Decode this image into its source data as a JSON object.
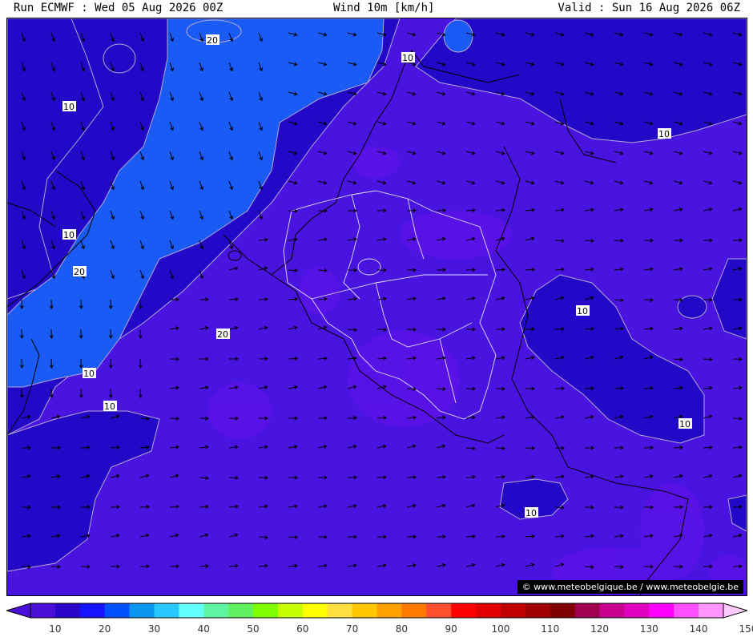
{
  "header": {
    "run": "Run ECMWF : Wed 05 Aug 2026 00Z",
    "field": "Wind 10m [km/h]",
    "valid": "Valid : Sun 16 Aug 2026 06Z"
  },
  "credit": "© www.meteobelgique.be / www.meteobelgie.be",
  "contour_labels": [
    "20",
    "10",
    "10",
    "10",
    "10",
    "20",
    "10",
    "20",
    "10",
    "10",
    "10",
    "10"
  ],
  "colorbar": {
    "labels": [
      "10",
      "20",
      "30",
      "40",
      "50",
      "60",
      "70",
      "80",
      "90",
      "100",
      "110",
      "120",
      "130",
      "140",
      "150"
    ],
    "colors": [
      "#4b10d8",
      "#2a06c8",
      "#1414ff",
      "#0050ff",
      "#0a96f0",
      "#28c8ff",
      "#64ffff",
      "#5ef5a0",
      "#60f060",
      "#7fff00",
      "#c8ff00",
      "#ffff00",
      "#ffe040",
      "#ffc800",
      "#ffa000",
      "#ff7800",
      "#ff5030",
      "#ff0000",
      "#e00000",
      "#c00000",
      "#a00000",
      "#800000",
      "#a00050",
      "#c80090",
      "#e000c0",
      "#ff00ff",
      "#ff50ff",
      "#ff96ff"
    ],
    "over_color": "#ffc8ff"
  },
  "palette": {
    "wind_0_10": "#4a14e0",
    "wind_10_20": "#2308c8",
    "wind_20_30": "#1a5af5",
    "contour": "#b4a8d2",
    "border": "#ffffff",
    "coast": "#000000"
  }
}
